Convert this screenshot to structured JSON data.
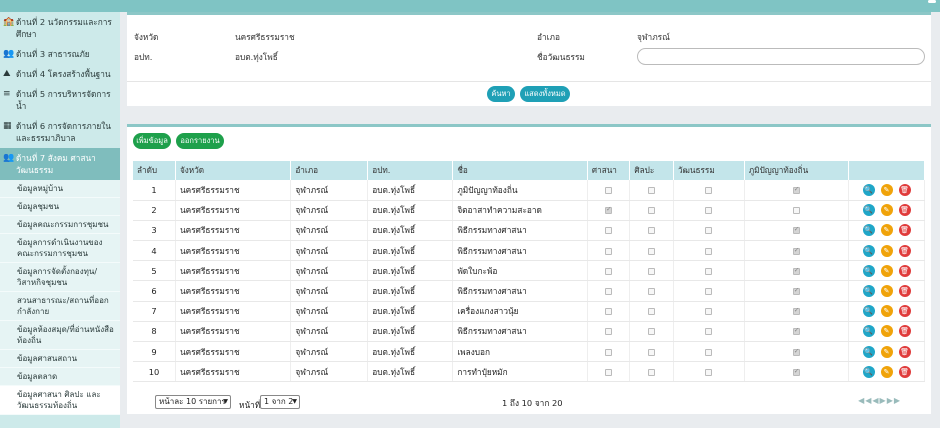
{
  "sidebar": {
    "items": [
      {
        "label": "ด้านที่ 2 นวัตกรรมและการศึกษา",
        "icon": "school-icon",
        "glyph": "🏫"
      },
      {
        "label": "ด้านที่ 3 สาธารณภัย",
        "icon": "people-warning-icon",
        "glyph": "👥"
      },
      {
        "label": "ด้านที่ 4 โครงสร้างพื้นฐาน",
        "icon": "road-icon",
        "glyph": "⛰"
      },
      {
        "label": "ด้านที่ 5 การบริหารจัดการน้ำ",
        "icon": "water-icon",
        "glyph": "≡"
      },
      {
        "label": "ด้านที่ 6 การจัดการภายในและธรรมาภิบาล",
        "icon": "building-icon",
        "glyph": "▦"
      },
      {
        "label": "ด้านที่ 7 สังคม ศาสนา วัฒนธรรม",
        "icon": "users-icon",
        "glyph": "👥"
      }
    ],
    "sub_items": [
      "ข้อมูลหมู่บ้าน",
      "ข้อมูลชุมชน",
      "ข้อมูลคณะกรรมการชุมชน",
      "ข้อมูลการดำเนินงานของคณะกรรมการชุมชน",
      "ข้อมูลการจัดตั้งกองทุน/วิสาหกิจชุมชน",
      "สวนสาธารณะ/สถานที่ออกกำลังกาย",
      "ข้อมูลห้องสมุด/ที่อ่านหนังสือท้องถิ่น",
      "ข้อมูลศาสนสถาน",
      "ข้อมูลตลาด",
      "ข้อมูลศาสนา ศิลปะ และวัฒนธรรมท้องถิ่น"
    ]
  },
  "search": {
    "province_label": "จังหวัด",
    "province_value": "นครศรีธรรมราช",
    "district_label": "อำเภอ",
    "district_value": "จุฬาภรณ์",
    "org_label": "อปท.",
    "org_value": "อบต.ทุ่งโพธิ์",
    "culture_label": "ชื่อวัฒนธรรม",
    "culture_value": "",
    "search_button": "ค้นหา",
    "show_all_button": "แสดงทั้งหมด"
  },
  "toolbar": {
    "add_button": "เพิ่มข้อมูล",
    "report_button": "ออกรายงาน"
  },
  "table": {
    "headers": [
      "ลำดับ",
      "จังหวัด",
      "อำเภอ",
      "อปท.",
      "ชื่อ",
      "ศาสนา",
      "ศิลปะ",
      "วัฒนธรรม",
      "ภูมิปัญญาท้องถิ่น",
      ""
    ],
    "rows": [
      {
        "no": "1",
        "province": "นครศรีธรรมราช",
        "district": "จุฬาภรณ์",
        "org": "อบต.ทุ่งโพธิ์",
        "name": "ภูมิปัญญาท้องถิ่น",
        "religion": false,
        "art": false,
        "culture": false,
        "wisdom": true
      },
      {
        "no": "2",
        "province": "นครศรีธรรมราช",
        "district": "จุฬาภรณ์",
        "org": "อบต.ทุ่งโพธิ์",
        "name": "จิตอาสาทำความสะอาด",
        "religion": true,
        "art": false,
        "culture": false,
        "wisdom": false
      },
      {
        "no": "3",
        "province": "นครศรีธรรมราช",
        "district": "จุฬาภรณ์",
        "org": "อบต.ทุ่งโพธิ์",
        "name": "พิธีกรรมทางศาสนา",
        "religion": false,
        "art": false,
        "culture": false,
        "wisdom": true
      },
      {
        "no": "4",
        "province": "นครศรีธรรมราช",
        "district": "จุฬาภรณ์",
        "org": "อบต.ทุ่งโพธิ์",
        "name": "พิธีกรรมทางศาสนา",
        "religion": false,
        "art": false,
        "culture": false,
        "wisdom": true
      },
      {
        "no": "5",
        "province": "นครศรีธรรมราช",
        "district": "จุฬาภรณ์",
        "org": "อบต.ทุ่งโพธิ์",
        "name": "พัดใบกะพ้อ",
        "religion": false,
        "art": false,
        "culture": false,
        "wisdom": true
      },
      {
        "no": "6",
        "province": "นครศรีธรรมราช",
        "district": "จุฬาภรณ์",
        "org": "อบต.ทุ่งโพธิ์",
        "name": "พิธีกรรมทางศาสนา",
        "religion": false,
        "art": false,
        "culture": false,
        "wisdom": true
      },
      {
        "no": "7",
        "province": "นครศรีธรรมราช",
        "district": "จุฬาภรณ์",
        "org": "อบต.ทุ่งโพธิ์",
        "name": "เครื่องแกงสาวนุ้ย",
        "religion": false,
        "art": false,
        "culture": false,
        "wisdom": true
      },
      {
        "no": "8",
        "province": "นครศรีธรรมราช",
        "district": "จุฬาภรณ์",
        "org": "อบต.ทุ่งโพธิ์",
        "name": "พิธีกรรมทางศาสนา",
        "religion": false,
        "art": false,
        "culture": false,
        "wisdom": true
      },
      {
        "no": "9",
        "province": "นครศรีธรรมราช",
        "district": "จุฬาภรณ์",
        "org": "อบต.ทุ่งโพธิ์",
        "name": "เพลงบอก",
        "religion": false,
        "art": false,
        "culture": false,
        "wisdom": true
      },
      {
        "no": "10",
        "province": "นครศรีธรรมราช",
        "district": "จุฬาภรณ์",
        "org": "อบต.ทุ่งโพธิ์",
        "name": "การทำปุ๋ยหมัก",
        "religion": false,
        "art": false,
        "culture": false,
        "wisdom": true
      }
    ]
  },
  "pager": {
    "per_page": "หน้าละ 10 รายการ",
    "page_label": "หน้าที่",
    "page_select": "1 จาก 2",
    "summary": "1 ถึง 10 จาก 20",
    "nav_glyphs": "◀◀◀▶▶▶"
  },
  "colors": {
    "accent": "#8cc7c7",
    "sidebar_bg": "#cdeaea",
    "active_item": "#7fbdbd",
    "search_btn": "#1fa0b6",
    "add_btn": "#1ea04b",
    "view_btn": "#1fa6c8",
    "edit_btn": "#f0a30a",
    "delete_btn": "#e03b3b"
  }
}
